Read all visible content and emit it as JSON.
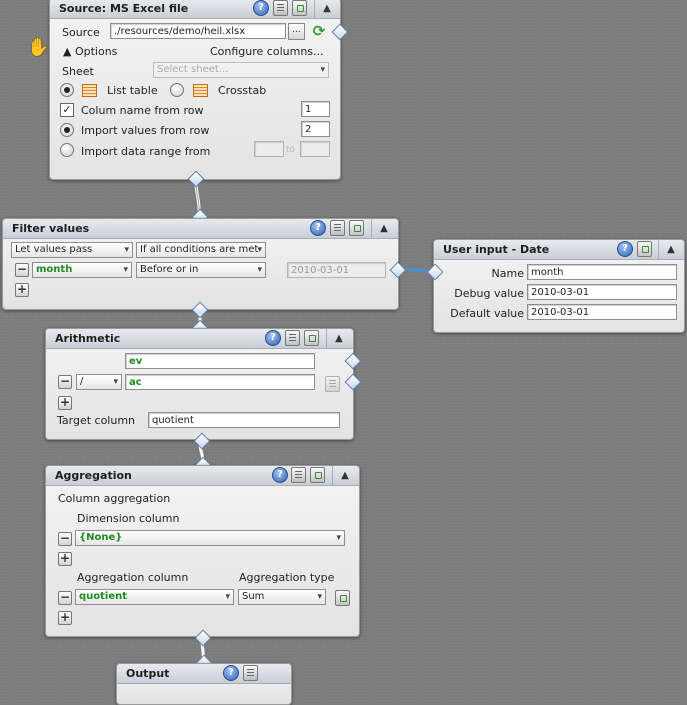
{
  "source_panel": {
    "title": "Source: MS Excel file",
    "source_label": "Source",
    "source_value": "./resources/demo/heil.xlsx",
    "dots_label": "...",
    "options_label": "Options",
    "configure_label": "Configure columns...",
    "sheet_label": "Sheet",
    "sheet_placeholder": "Select sheet...",
    "list_table_label": "List table",
    "crosstab_label": "Crosstab",
    "colname_label": "Colum name from row",
    "colname_value": "1",
    "import_label": "Import values from row",
    "import_value": "2",
    "range_label": "Import data range from",
    "range_to": "to"
  },
  "filter_panel": {
    "title": "Filter values",
    "mode": "Let values pass",
    "condition": "If all conditions are met",
    "column": "month",
    "operator": "Before or in",
    "value": "2010-03-01"
  },
  "user_input_panel": {
    "title": "User input - Date",
    "name_label": "Name",
    "name_value": "month",
    "debug_label": "Debug value",
    "debug_value": "2010-03-01",
    "default_label": "Default value",
    "default_value": "2010-03-01"
  },
  "arith_panel": {
    "title": "Arithmetic",
    "operand1": "ev",
    "operator": "/",
    "operand2": "ac",
    "target_label": "Target column",
    "target_value": "quotient"
  },
  "agg_panel": {
    "title": "Aggregation",
    "column_agg_label": "Column aggregation",
    "dimension_label": "Dimension column",
    "dimension_value": "{None}",
    "agg_column_label": "Aggregation column",
    "agg_type_label": "Aggregation type",
    "agg_column_value": "quotient",
    "agg_type_value": "Sum"
  },
  "output_panel": {
    "title": "Output"
  },
  "icons": {
    "help": "?",
    "collapse": "▲",
    "minus": "−",
    "plus": "+"
  },
  "colors": {
    "accent_green": "#1f8a1f",
    "wire_blue": "#4a90d0",
    "background": "#7c7c7c"
  }
}
